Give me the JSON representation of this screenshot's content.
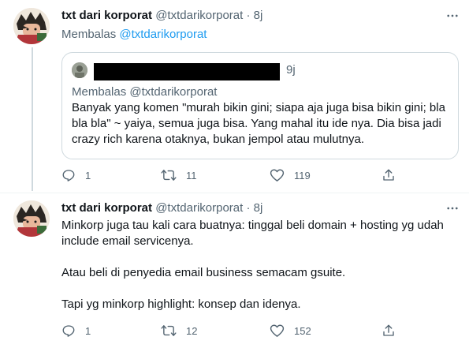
{
  "tweets": [
    {
      "name": "txt dari korporat",
      "handle": "@txtdarikorporat",
      "dot": "·",
      "time": "8j",
      "reply_prefix": "Membalas",
      "reply_to": "@txtdarikorporat",
      "quote": {
        "time": "9j",
        "reply_line": "Membalas @txtdarikorporat",
        "text": "Banyak yang komen \"murah bikin gini; siapa aja juga bisa bikin gini; bla bla bla\" ~ yaiya, semua juga bisa. Yang mahal itu ide nya. Dia bisa jadi crazy rich karena otaknya, bukan jempol atau mulutnya."
      },
      "stats": {
        "replies": "1",
        "retweets": "11",
        "likes": "119"
      }
    },
    {
      "name": "txt dari korporat",
      "handle": "@txtdarikorporat",
      "dot": "·",
      "time": "8j",
      "paragraphs": [
        "Minkorp juga tau kali cara buatnya: tinggal beli domain + hosting yg udah include email servicenya.",
        "Atau beli di penyedia email business semacam gsuite.",
        "Tapi yg minkorp highlight: konsep dan idenya."
      ],
      "stats": {
        "replies": "1",
        "retweets": "12",
        "likes": "152"
      }
    }
  ],
  "colors": {
    "text": "#0f1419",
    "muted": "#536471",
    "link": "#1d9bf0",
    "border": "#cfd9de"
  },
  "icons": [
    "more-icon",
    "reply-icon",
    "retweet-icon",
    "like-icon",
    "share-icon"
  ]
}
